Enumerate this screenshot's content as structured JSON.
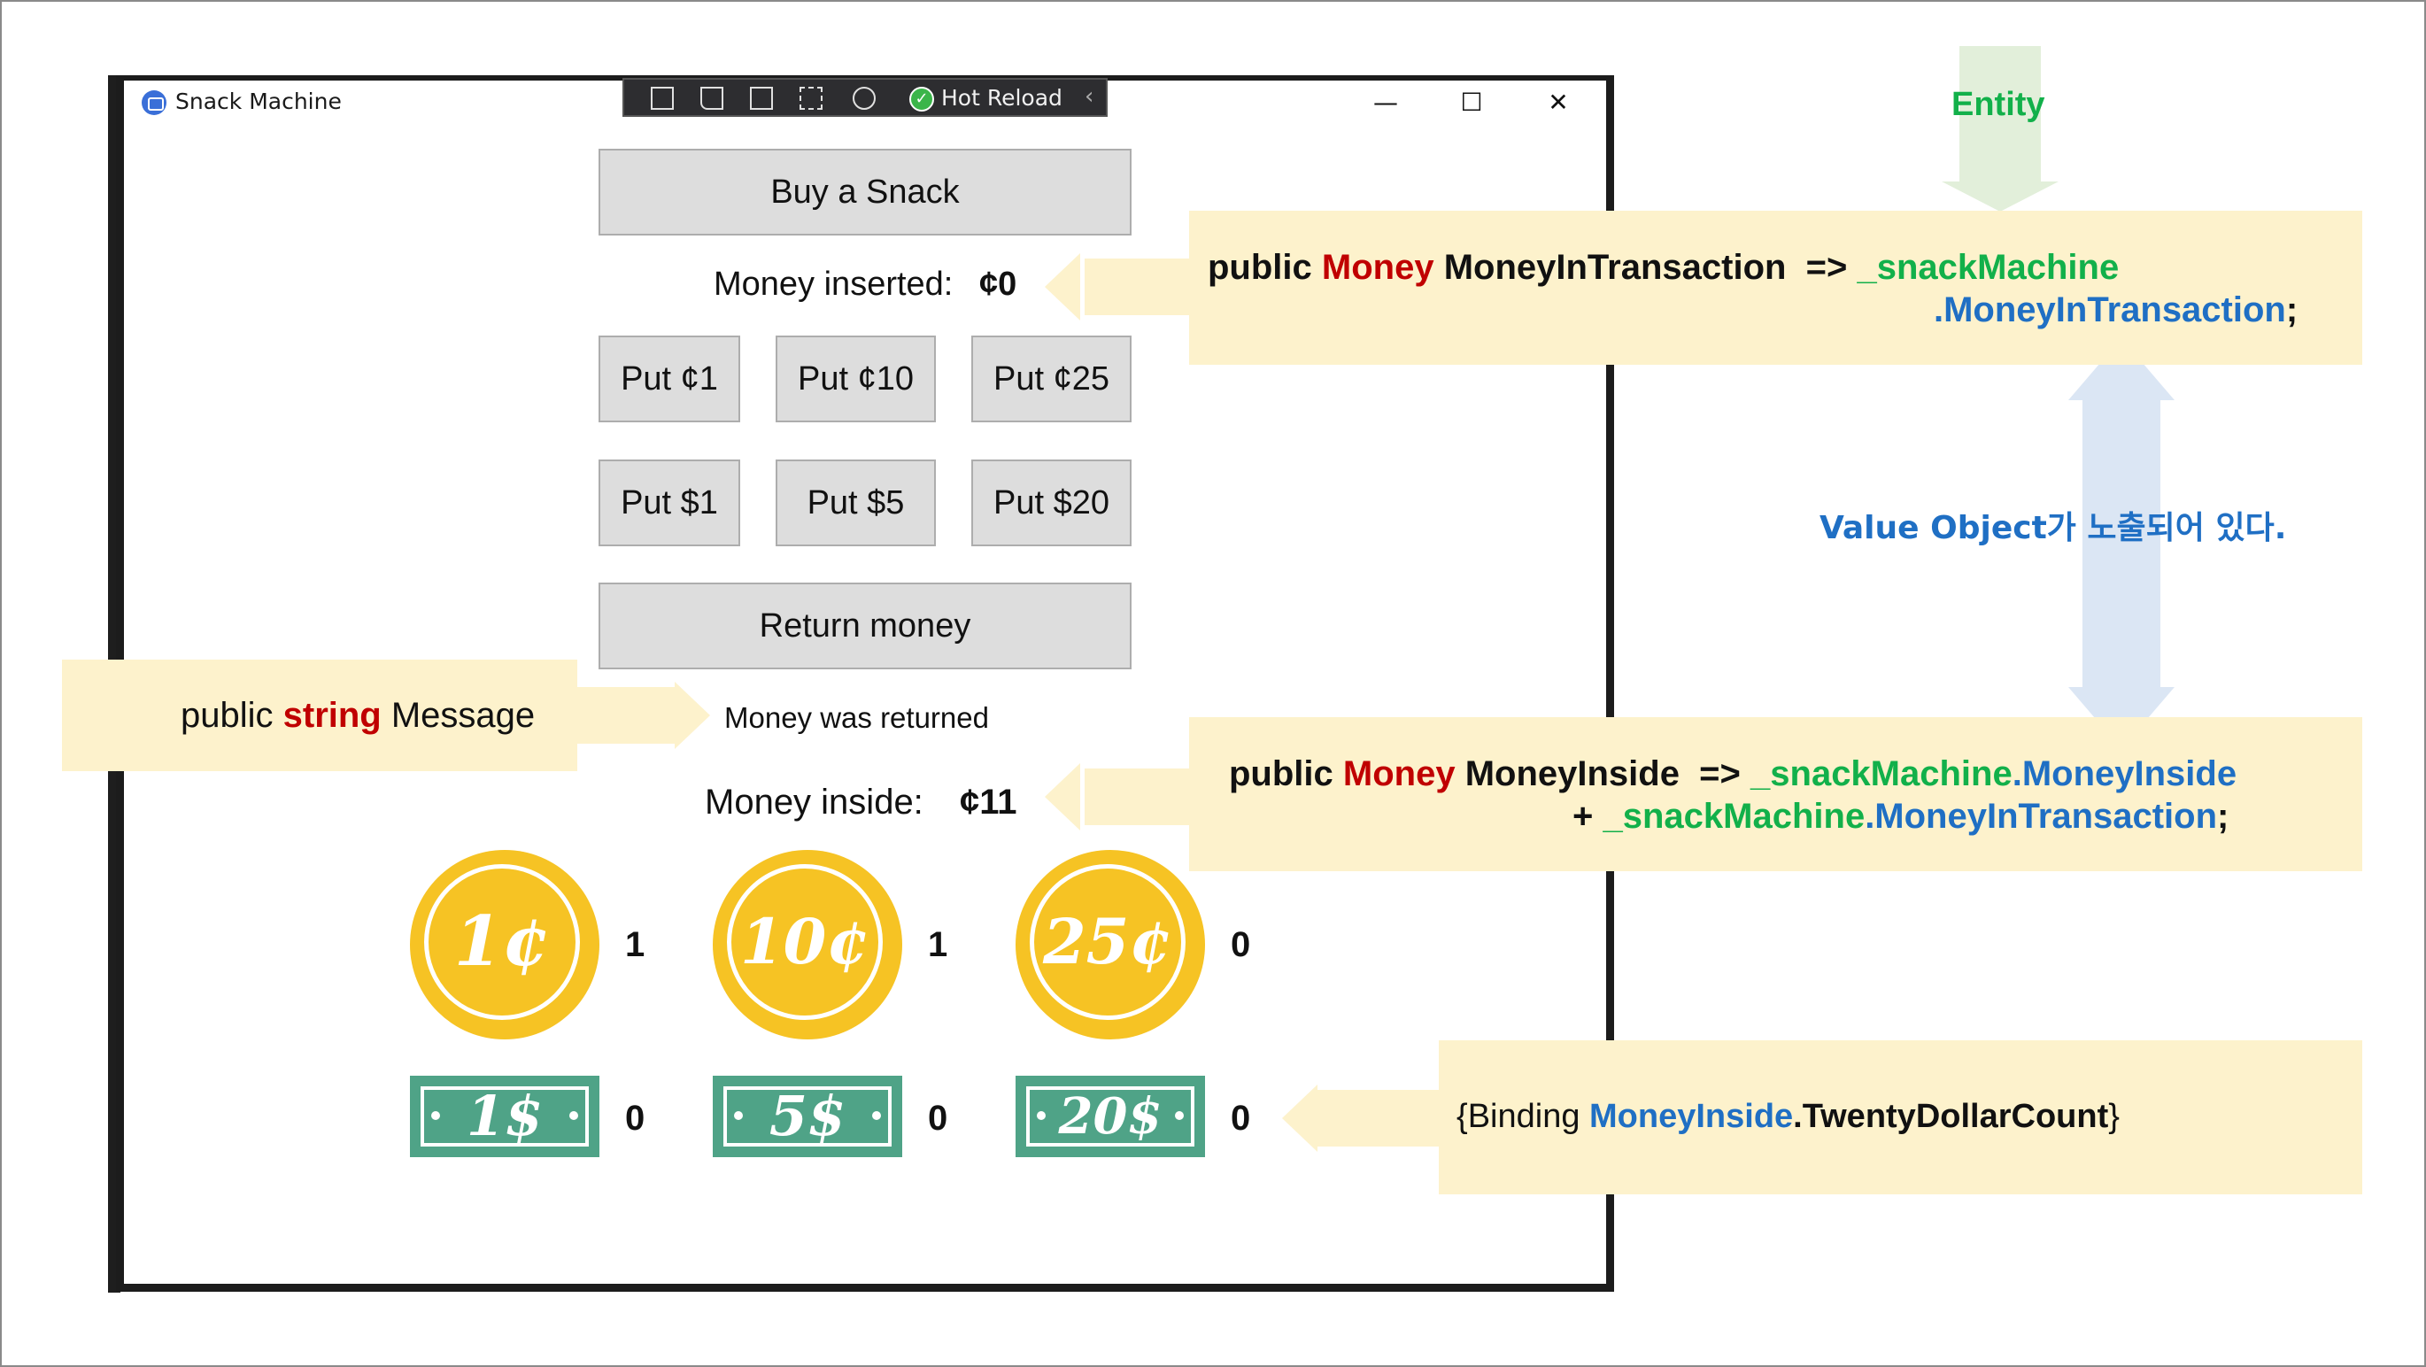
{
  "window": {
    "title": "Snack Machine",
    "minimize_glyph": "—",
    "maximize_glyph": "☐",
    "close_glyph": "✕"
  },
  "devtools": {
    "hot_reload_label": "Hot Reload",
    "check_glyph": "✓",
    "chevron_glyph": "‹"
  },
  "machine": {
    "buy_label": "Buy a Snack",
    "money_inserted_label": "Money inserted:",
    "money_inserted_value": "¢0",
    "put_buttons": [
      "Put ¢1",
      "Put ¢10",
      "Put ¢25",
      "Put $1",
      "Put $5",
      "Put $20"
    ],
    "return_label": "Return money",
    "message": "Money was returned",
    "money_inside_label": "Money inside:",
    "money_inside_value": "¢11",
    "coins": [
      {
        "label": "1¢",
        "count": "1"
      },
      {
        "label": "10¢",
        "count": "1"
      },
      {
        "label": "25¢",
        "count": "0"
      }
    ],
    "bills": [
      {
        "label": "1$",
        "count": "0"
      },
      {
        "label": "5$",
        "count": "0"
      },
      {
        "label": "20$",
        "count": "0"
      }
    ]
  },
  "annotations": {
    "entity_label": "Entity",
    "value_object_label": "Value Object가 노출되어 있다.",
    "message_code": {
      "kw": "public ",
      "type": "string",
      "name": " Message"
    },
    "transaction_code": {
      "kw": "public ",
      "type": "Money",
      "name": " MoneyInTransaction  => ",
      "field": "_snackMachine",
      "prop": ".MoneyInTransaction",
      "end": ";"
    },
    "inside_code": {
      "kw": "public ",
      "type": "Money",
      "name": " MoneyInside  => ",
      "field1": "_snackMachine",
      "prop1": ".MoneyInside",
      "plus": "+ ",
      "field2": "_snackMachine",
      "prop2": ".MoneyInTransaction",
      "end": ";"
    },
    "binding_code": {
      "open": "{Binding ",
      "path1": "MoneyInside",
      "path2": ".TwentyDollarCount",
      "close": "}"
    }
  },
  "colors": {
    "keyword_type": "#c00000",
    "field": "#12b04a",
    "property": "#1f6fc4",
    "note_bg": "#fdf2cc",
    "coin": "#f6c324",
    "bill": "#4fa387"
  }
}
